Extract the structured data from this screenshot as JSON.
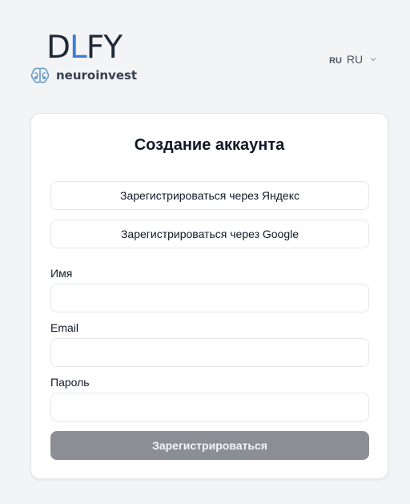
{
  "header": {
    "logo_prefix": "D",
    "logo_accent": "L",
    "logo_suffix": "FY",
    "logo_sub": "neuroinvest",
    "lang_small": "RU",
    "lang_current": "RU",
    "icons": {
      "brand": "brain-icon",
      "lang_dropdown": "chevron-down-icon"
    }
  },
  "form": {
    "title": "Создание аккаунта",
    "oauth_yandex": "Зарегистрироваться через Яндекс",
    "oauth_google": "Зарегистрироваться через Google",
    "name_label": "Имя",
    "name_value": "",
    "email_label": "Email",
    "email_value": "",
    "password_label": "Пароль",
    "password_value": "",
    "submit_label": "Зарегистрироваться"
  },
  "colors": {
    "background": "#f3f4f6",
    "accent": "#3b7dd8",
    "submit_disabled": "#8b8e95"
  }
}
